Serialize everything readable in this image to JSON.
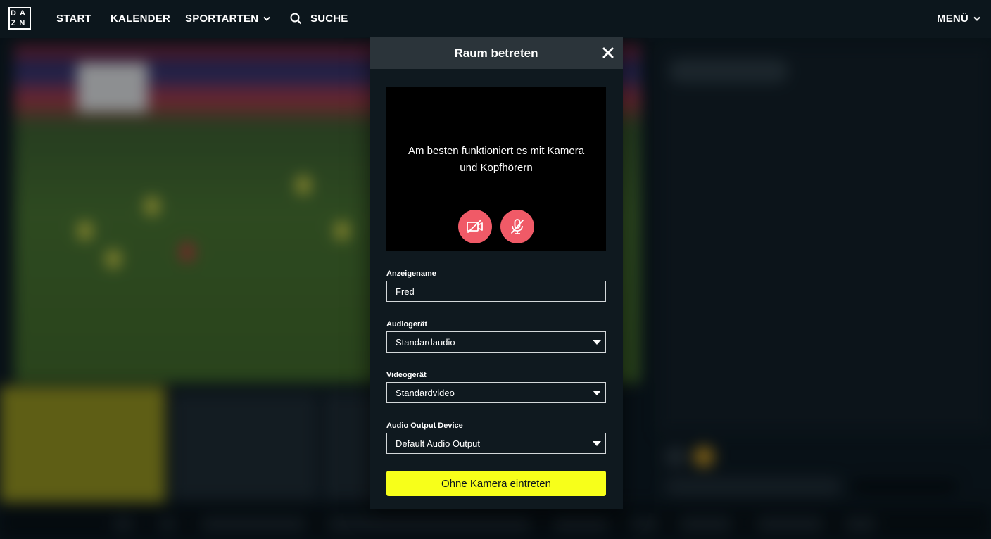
{
  "nav": {
    "logo_letters": [
      "DA",
      "ZN"
    ],
    "items": [
      {
        "label": "START"
      },
      {
        "label": "KALENDER"
      },
      {
        "label": "SPORTARTEN"
      },
      {
        "label": "SUCHE"
      }
    ],
    "menu_label": "MENÜ"
  },
  "modal": {
    "title": "Raum betreten",
    "preview_text": "Am besten funktioniert es mit Kamera und Kopfhörern",
    "camera_button_icon": "camera-off-icon",
    "mic_button_icon": "mic-off-icon",
    "display_name": {
      "label": "Anzeigename",
      "value": "Fred"
    },
    "audio_device": {
      "label": "Audiogerät",
      "value": "Standardaudio"
    },
    "video_device": {
      "label": "Videogerät",
      "value": "Standardvideo"
    },
    "audio_output": {
      "label": "Audio Output Device",
      "value": "Default Audio Output"
    },
    "primary_button": "Ohne Kamera eintreten"
  },
  "colors": {
    "accent_yellow": "#f7ff1a",
    "mute_red": "#f05a67",
    "background": "#0c161c",
    "modal_header": "#2b343a"
  }
}
